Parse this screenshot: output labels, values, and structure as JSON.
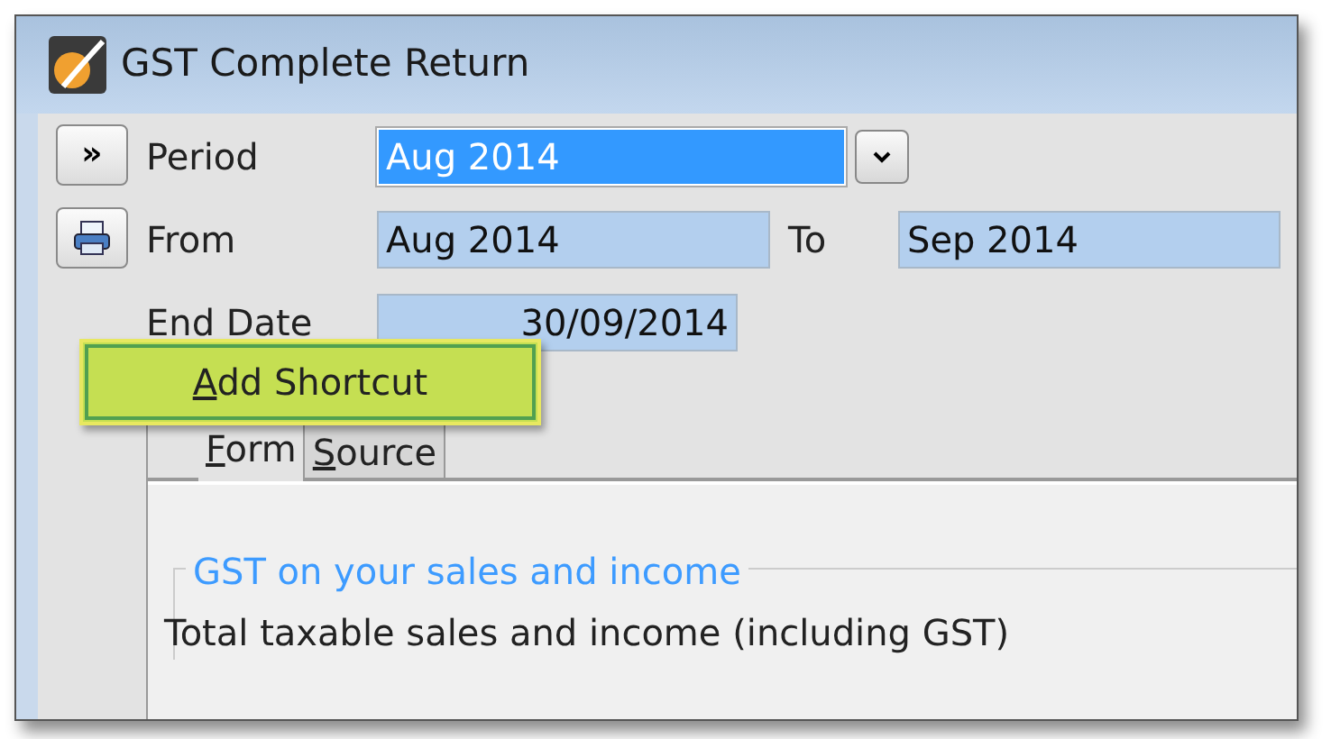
{
  "window": {
    "title": "GST Complete Return"
  },
  "side_buttons": [
    {
      "kind": "expand",
      "label": "»"
    },
    {
      "kind": "print"
    }
  ],
  "period": {
    "label": "Period",
    "value": "Aug 2014",
    "selected": true
  },
  "from": {
    "label": "From",
    "value": "Aug 2014"
  },
  "to": {
    "label": "To",
    "value": "Sep 2014"
  },
  "end_date": {
    "label": "End Date",
    "value": "30/09/2014"
  },
  "popup": {
    "label": "Add Shortcut"
  },
  "tabs": [
    {
      "label": "Form",
      "selected": true
    },
    {
      "label": "Source",
      "selected": false
    }
  ],
  "group": {
    "title": "GST on your sales and income",
    "rows": [
      "Total taxable sales and income (including GST)"
    ]
  }
}
